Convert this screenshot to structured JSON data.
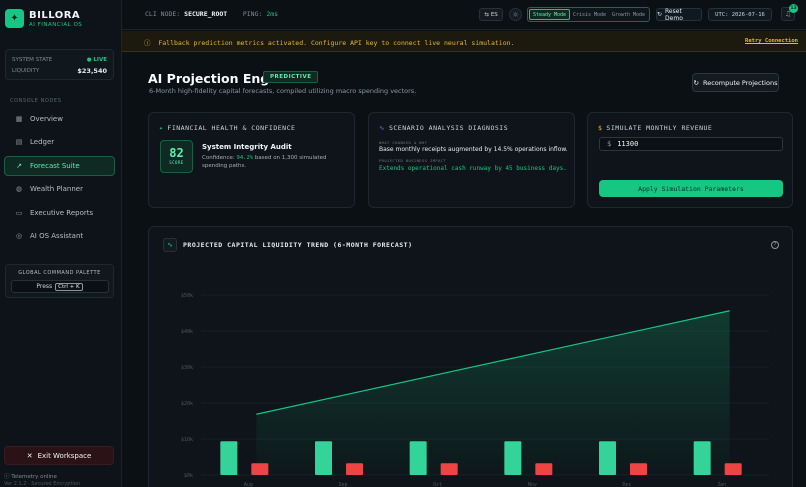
{
  "brand": {
    "name": "BILLORA",
    "subtitle": "AI FINANCIAL OS",
    "logo_icon": "sparkle-icon"
  },
  "system": {
    "state_label": "SYSTEM STATE",
    "state_value": "● LIVE",
    "liquidity_label": "LIQUIDITY",
    "liquidity_value": "$23,540"
  },
  "sidebar": {
    "section_label": "CONSOLE NODES",
    "items": [
      {
        "label": "Overview",
        "icon": "grid-icon",
        "active": false
      },
      {
        "label": "Ledger",
        "icon": "ledger-icon",
        "active": false
      },
      {
        "label": "Forecast Suite",
        "icon": "trend-icon",
        "active": true
      },
      {
        "label": "Wealth Planner",
        "icon": "globe-icon",
        "active": false
      },
      {
        "label": "Executive Reports",
        "icon": "document-icon",
        "active": false
      },
      {
        "label": "AI OS Assistant",
        "icon": "bot-icon",
        "active": false
      }
    ],
    "palette_title": "GLOBAL COMMAND PALETTE",
    "palette_press": "Press",
    "palette_key": "Ctrl + K",
    "exit_label": "Exit Workspace",
    "telemetry": "Telemetry online",
    "version": "Ver 2.1.2 · Secured Encryption"
  },
  "topbar": {
    "cli_label": "CLI NODE:",
    "cli_value": "SECURE_ROOT",
    "ping_label": "PING:",
    "ping_value": "2ms",
    "lang": "ES",
    "modes": [
      "Steady Mode",
      "Crisis Mode",
      "Growth Mode"
    ],
    "active_mode": "Steady Mode",
    "reset_label": "Reset Demo",
    "utc": "UTC: 2026-07-16",
    "notif_count": "13"
  },
  "alert": {
    "message": "Fallback prediction metrics activated. Configure API key to connect live neural simulation.",
    "link": "Retry Connection"
  },
  "header": {
    "title": "AI Projection Engine",
    "badge": "PREDICTIVE",
    "subtitle": "6-Month high-fidelity capital forecasts, compiled utilizing macro spending vectors.",
    "recompute_label": "Recompute Projections"
  },
  "health_card": {
    "title": "FINANCIAL HEALTH & CONFIDENCE",
    "score": "82",
    "score_label": "SCORE",
    "audit_title": "System Integrity Audit",
    "audit_prefix": "Confidence:",
    "audit_confidence": "94.2%",
    "audit_suffix": "based on 1,300 simulated spending paths."
  },
  "diagnosis_card": {
    "title": "SCENARIO ANALYSIS DIAGNOSIS",
    "what_label": "WHAT CHANGED & WHY",
    "what_value": "Base monthly receipts augmented by 14.5% operations inflow.",
    "impact_label": "PROJECTED BUSINESS IMPACT",
    "impact_value": "Extends operational cash runway by 45 business days."
  },
  "simulate_card": {
    "title": "SIMULATE MONTHLY REVENUE",
    "currency": "$",
    "input_value": "11300",
    "button_label": "Apply Simulation Parameters"
  },
  "chart_data": {
    "type": "bar",
    "title": "PROJECTED CAPITAL LIQUIDITY TREND (6-MONTH FORECAST)",
    "categories": [
      "Aug",
      "Sep",
      "Oct",
      "Nov",
      "Dec",
      "Jan"
    ],
    "y_ticks": [
      "$0k",
      "$10k",
      "$20k",
      "$30k",
      "$40k",
      "$50k"
    ],
    "ylim": [
      0,
      40000
    ],
    "series": [
      {
        "kind": "bar",
        "values": [
          7500,
          7500,
          7500,
          7500,
          7500,
          7500
        ],
        "color": "#34d399"
      },
      {
        "kind": "bar",
        "values": [
          2600,
          2600,
          2600,
          2600,
          2600,
          2600
        ],
        "color": "#ef4444"
      },
      {
        "kind": "area",
        "values": [
          13500,
          18100,
          22700,
          27300,
          31900,
          36500
        ],
        "color": "#16c784"
      }
    ],
    "grid": true
  },
  "colors": {
    "accent": "#16c784",
    "warning": "#e8b931",
    "danger": "#ef4444",
    "background": "#0b1014"
  }
}
